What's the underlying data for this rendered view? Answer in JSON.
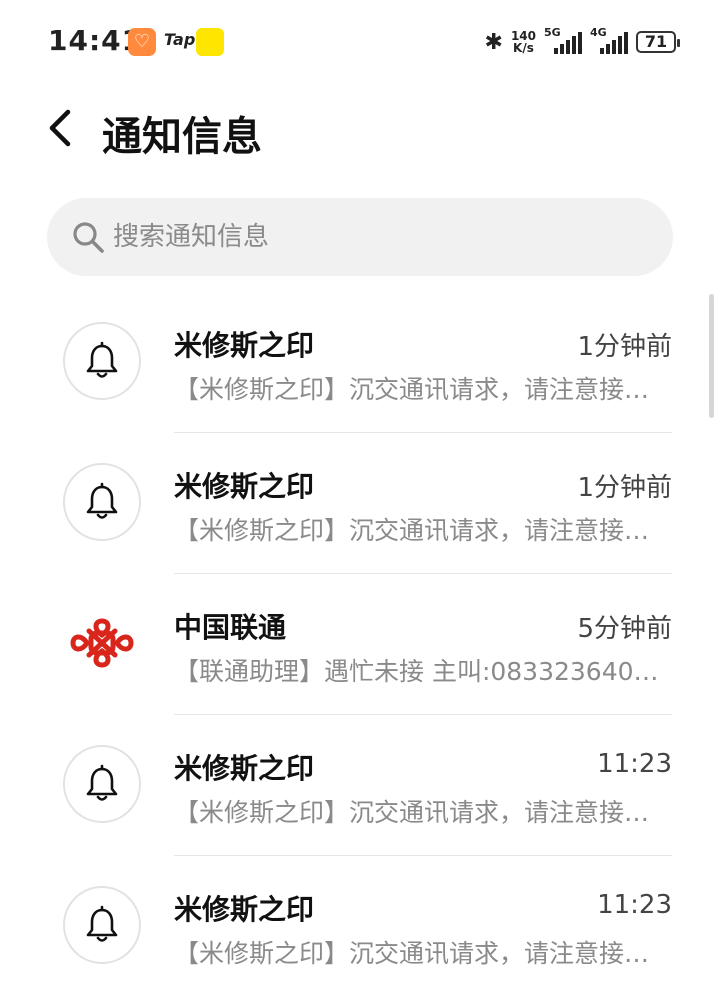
{
  "status_bar": {
    "time": "14:41",
    "app2_label": "Tap",
    "net_speed_value": "140",
    "net_speed_unit": "K/s",
    "signal1_label": "5G",
    "signal2_label": "4G",
    "battery": "71"
  },
  "header": {
    "title": "通知信息"
  },
  "search": {
    "placeholder": "搜索通知信息",
    "value": ""
  },
  "notifications": [
    {
      "title": "米修斯之印",
      "time": "1分钟前",
      "preview": "【米修斯之印】沉交通讯请求，请注意接…",
      "icon": "bell-icon"
    },
    {
      "title": "米修斯之印",
      "time": "1分钟前",
      "preview": "【米修斯之印】沉交通讯请求，请注意接…",
      "icon": "bell-icon"
    },
    {
      "title": "中国联通",
      "time": "5分钟前",
      "preview": "【联通助理】遇忙未接 主叫:083323640…",
      "icon": "china-unicom-logo-icon"
    },
    {
      "title": "米修斯之印",
      "time": "11:23",
      "preview": "【米修斯之印】沉交通讯请求，请注意接…",
      "icon": "bell-icon"
    },
    {
      "title": "米修斯之印",
      "time": "11:23",
      "preview": "【米修斯之印】沉交通讯请求，请注意接…",
      "icon": "bell-icon"
    }
  ],
  "colors": {
    "accent_unicom": "#d9261c",
    "search_bg": "#f1f1f1",
    "muted_text": "#8a8a8a"
  }
}
